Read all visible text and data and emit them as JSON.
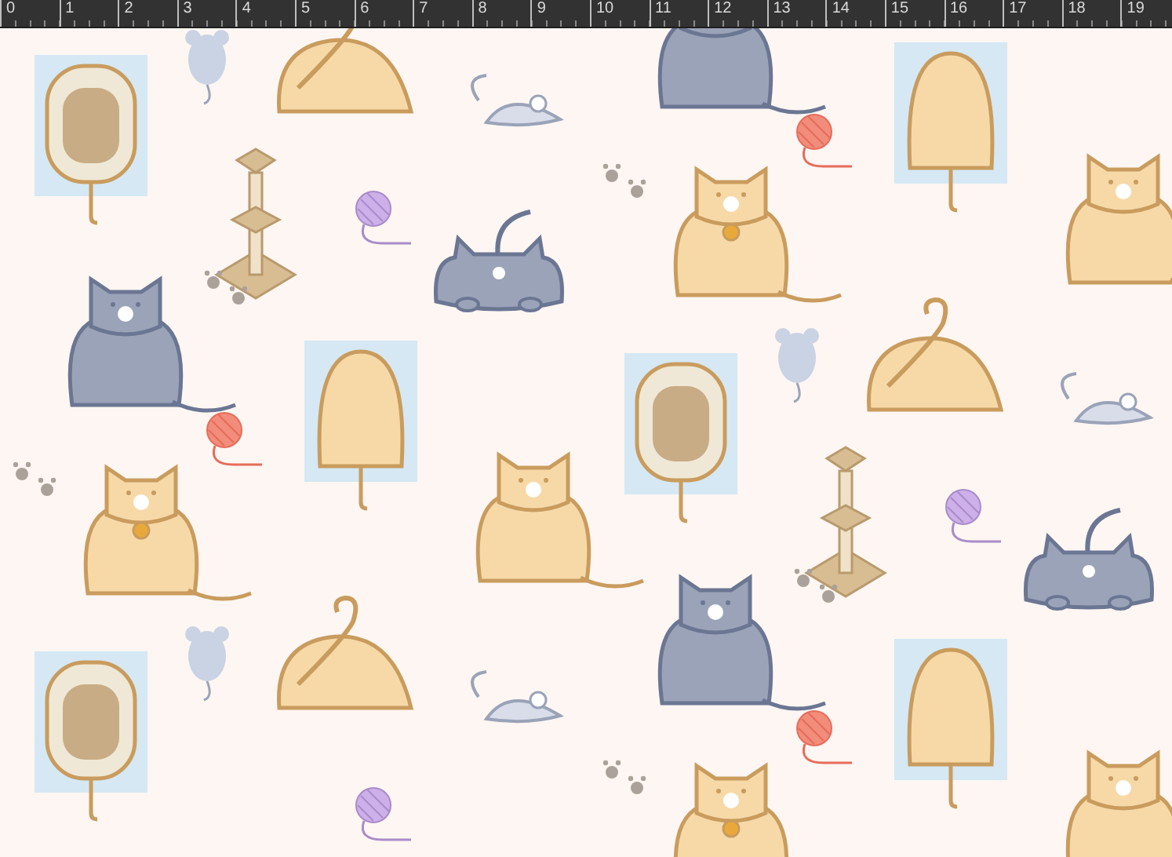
{
  "ruler": {
    "labels": [
      "0",
      "1",
      "2",
      "3",
      "4",
      "5",
      "6",
      "7",
      "8",
      "9",
      "10",
      "11",
      "12",
      "13",
      "14",
      "15",
      "16",
      "17",
      "18",
      "19"
    ]
  }
}
